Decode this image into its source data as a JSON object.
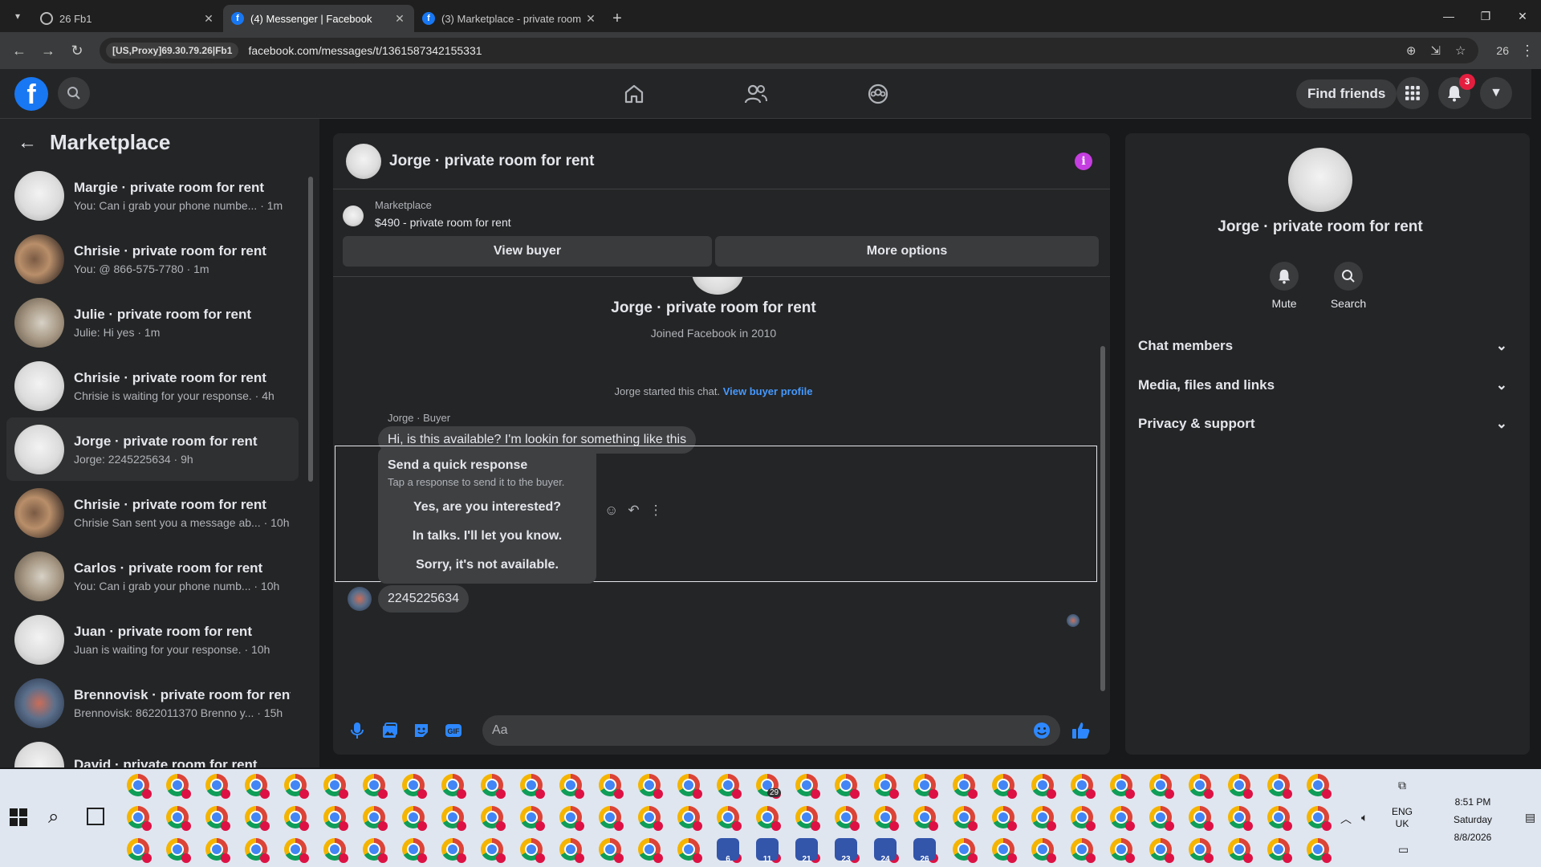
{
  "browser": {
    "tabs": [
      {
        "title": "26 Fb1",
        "icon": "globe-icon",
        "active": false
      },
      {
        "title": "(4) Messenger | Facebook",
        "icon": "facebook-icon",
        "active": true
      },
      {
        "title": "(3) Marketplace - private room",
        "icon": "facebook-icon",
        "active": false
      }
    ],
    "proxy_label": "[US,Proxy]69.30.79.26|Fb1",
    "url": "facebook.com/messages/t/1361587342155331",
    "profile_number": "26"
  },
  "fb_header": {
    "logo": "f",
    "find_friends_label": "Find friends",
    "notification_count": "3"
  },
  "sidebar": {
    "title": "Marketplace",
    "conversations": [
      {
        "name": "Margie · private room for rent",
        "preview": "You: Can i grab your phone numbe... · 1m",
        "avatar": "white"
      },
      {
        "name": "Chrisie · private room for rent",
        "preview": "You: @ 866-575-7780 · 1m",
        "avatar": "room"
      },
      {
        "name": "Julie · private room for rent",
        "preview": "Julie: Hi yes · 1m",
        "avatar": "room2"
      },
      {
        "name": "Chrisie · private room for rent",
        "preview": "Chrisie is waiting for your response. · 4h",
        "avatar": "white"
      },
      {
        "name": "Jorge · private room for rent",
        "preview": "Jorge: 2245225634 · 9h",
        "avatar": "white",
        "active": true
      },
      {
        "name": "Chrisie · private room for rent",
        "preview": "Chrisie San sent you a message ab... · 10h",
        "avatar": "room"
      },
      {
        "name": "Carlos · private room for rent",
        "preview": "You: Can i grab your phone numb... · 10h",
        "avatar": "room2"
      },
      {
        "name": "Juan · private room for rent",
        "preview": "Juan is waiting for your response. · 10h",
        "avatar": "white"
      },
      {
        "name": "Brennovisk · private room for rent",
        "preview": "Brennovisk: 8622011370 Brenno y... · 15h",
        "avatar": "blue"
      },
      {
        "name": "David · private room for rent",
        "preview": "",
        "avatar": "white"
      }
    ]
  },
  "chat": {
    "title": "Jorge · private room for rent",
    "marketplace_label": "Marketplace",
    "listing": "$490 - private room for rent",
    "view_buyer": "View buyer",
    "more_options": "More options",
    "profile_name": "Jorge · private room for rent",
    "joined": "Joined Facebook in 2010",
    "started_text": "Jorge started this chat.",
    "view_buyer_profile": "View buyer profile",
    "sender_label": "Jorge · Buyer",
    "message1": "Hi, is this available? I'm lookin for something like this",
    "quick_title": "Send a quick response",
    "quick_sub": "Tap a response to send it to the buyer.",
    "quick_options": [
      "Yes, are you interested?",
      "In talks. I'll let you know.",
      "Sorry, it's not available."
    ],
    "message2": "2245225634",
    "composer_placeholder": "Aa"
  },
  "details": {
    "name": "Jorge · private room for rent",
    "mute": "Mute",
    "search": "Search",
    "sections": [
      "Chat members",
      "Media, files and links",
      "Privacy & support"
    ]
  },
  "taskbar": {
    "whatsapp_badge": "29",
    "profile_numbers": [
      "6",
      "11",
      "21",
      "23",
      "24",
      "26"
    ],
    "lang_line1": "ENG",
    "lang_line2": "UK",
    "time": "8:51 PM",
    "day": "Saturday",
    "date": "8/8/2026"
  },
  "colors": {
    "fb_blue": "#1877f2",
    "link_blue": "#4599ff",
    "info_purple": "#c53ee0",
    "badge_red": "#e41e3f"
  }
}
